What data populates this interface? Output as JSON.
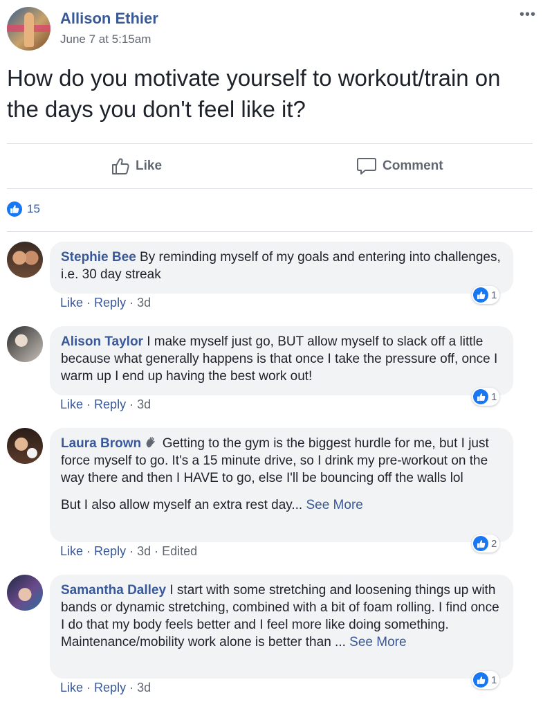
{
  "post": {
    "author": "Allison Ethier",
    "time": "June 7 at 5:15am",
    "more_icon": "•••",
    "text": "How do you motivate yourself to workout/train on the days you don't feel like it?"
  },
  "actions": {
    "like_label": "Like",
    "comment_label": "Comment"
  },
  "reactions": {
    "count": "15"
  },
  "colors": {
    "link": "#385898",
    "like_blue": "#1877f2",
    "bubble": "#f2f3f5"
  },
  "comments": [
    {
      "name": "Stephie Bee",
      "text": "By reminding myself of my goals and entering into challenges, i.e. 30 day streak",
      "like": "Like",
      "reply": "Reply",
      "time": "3d",
      "reactions": "1"
    },
    {
      "name": "Alison Taylor",
      "text": "I make myself just go, BUT allow myself to slack off a little because what generally happens is that once I take the pressure off, once I warm up I end up having the best work out!",
      "like": "Like",
      "reply": "Reply",
      "time": "3d",
      "reactions": "1"
    },
    {
      "name": "Laura Brown",
      "badge_icon": "waving-hand-icon",
      "text": "Getting to the gym is the biggest hurdle for me, but I just force myself to go. It's a 15 minute drive, so I drink my pre-workout on the way there and then I HAVE to go, else I'll be bouncing off the walls lol",
      "text2": "But I also allow myself an extra rest day...",
      "see_more": "See More",
      "like": "Like",
      "reply": "Reply",
      "time": "3d",
      "edited": "Edited",
      "reactions": "2"
    },
    {
      "name": "Samantha Dalley",
      "text": "I start with some stretching and loosening things up with bands or dynamic stretching, combined with a bit of foam rolling. I find once I do that my body feels better and I feel more like doing something. Maintenance/mobility work alone is better than ...",
      "see_more": "See More",
      "like": "Like",
      "reply": "Reply",
      "time": "3d",
      "reactions": "1"
    }
  ]
}
